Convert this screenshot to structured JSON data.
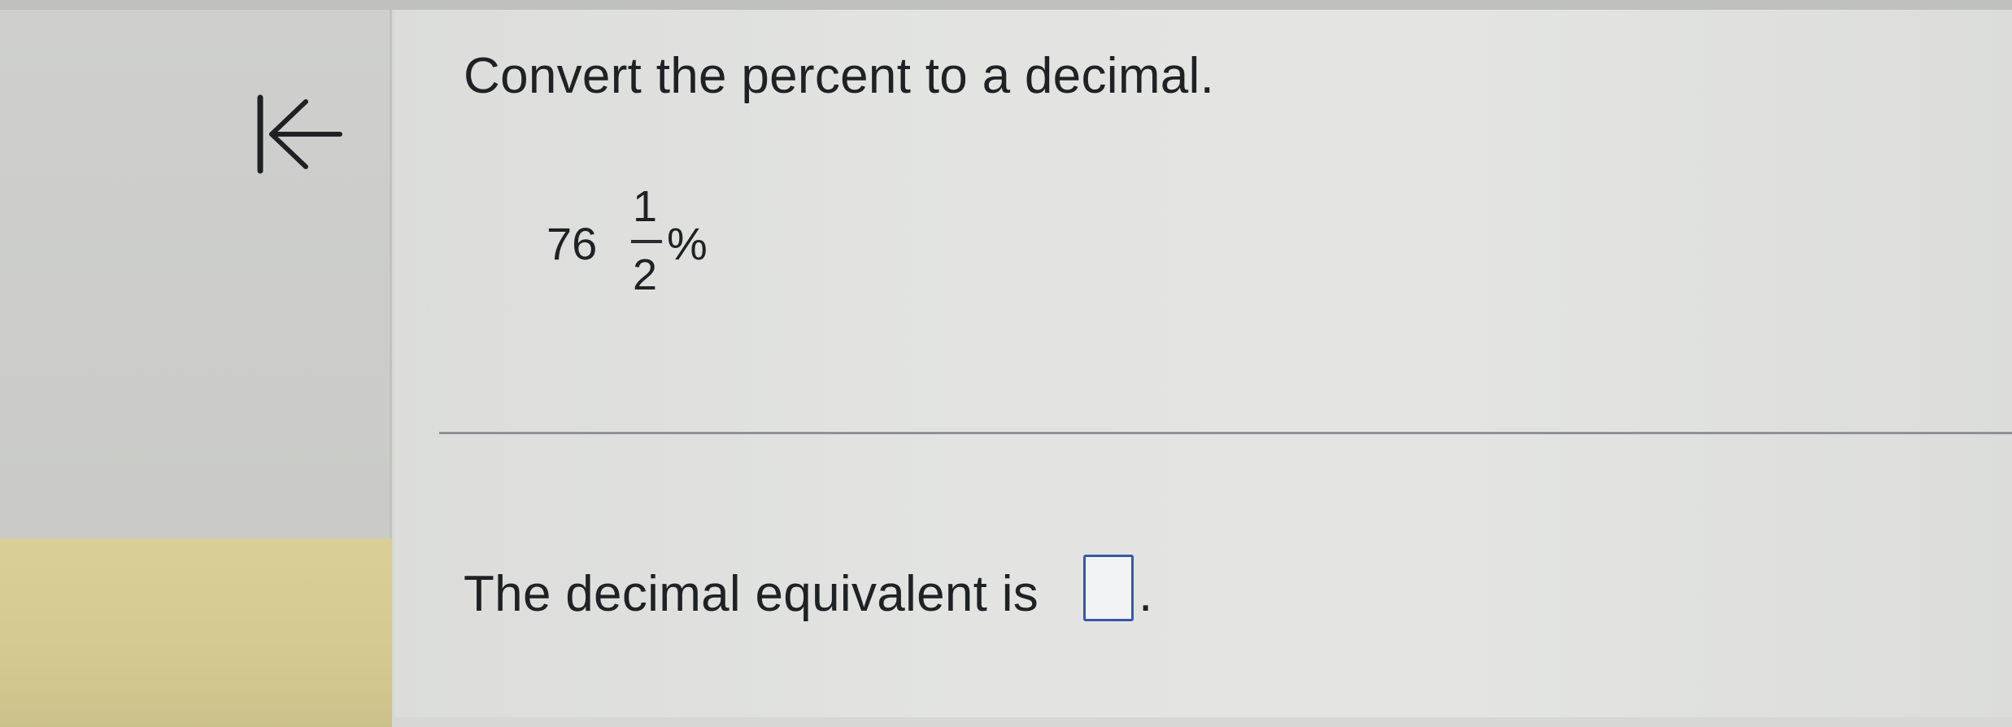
{
  "question": {
    "title": "Convert the percent to a decimal."
  },
  "expression": {
    "whole": "76",
    "numerator": "1",
    "denominator": "2",
    "percent_sign": "%"
  },
  "answer": {
    "prompt": "The decimal equivalent is",
    "input_value": "",
    "period": "."
  },
  "icons": {
    "back": "collapse-left-arrow-icon"
  },
  "colors": {
    "input_border": "#3a57a8",
    "sidebar_highlight": "#d9cf97"
  }
}
